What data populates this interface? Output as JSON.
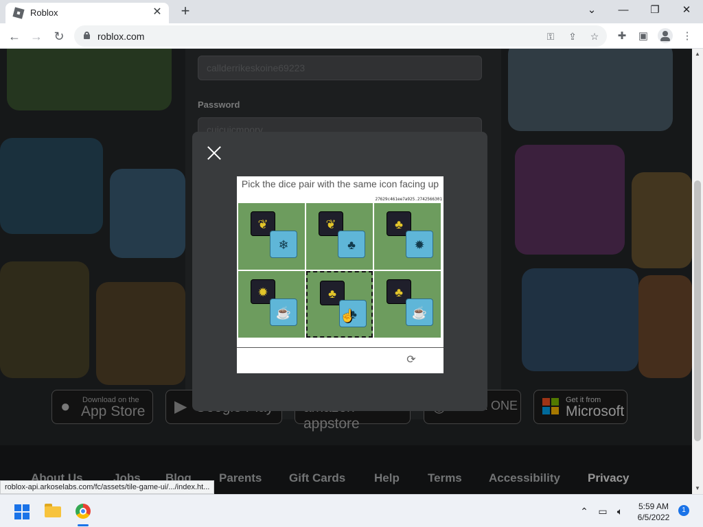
{
  "browser": {
    "tab_title": "Roblox",
    "url": "roblox.com",
    "tab_close": "✕",
    "new_tab": "+"
  },
  "login": {
    "username_value": "callderrikeskoine69223",
    "password_label": "Password",
    "password_value": "cuicuicmpory"
  },
  "captcha": {
    "prompt": "Pick the dice pair with the same icon facing up",
    "session_id": "27629c461ee7a925.2742566301",
    "selected_index": 4,
    "tiles": [
      {
        "dice": [
          "leaf",
          "snowflake"
        ]
      },
      {
        "dice": [
          "leaf",
          "tree"
        ]
      },
      {
        "dice": [
          "tree",
          "sun"
        ]
      },
      {
        "dice": [
          "sun",
          "cup"
        ]
      },
      {
        "dice": [
          "tree",
          "tree"
        ]
      },
      {
        "dice": [
          "tree",
          "cup"
        ]
      }
    ]
  },
  "store_badges": [
    {
      "small": "Download on the",
      "big": "App Store"
    },
    {
      "small": "",
      "big": "Google Play"
    },
    {
      "small": "",
      "big": "amazon appstore"
    },
    {
      "small": "",
      "big": "XBOX ONE"
    },
    {
      "small": "Get it from",
      "big": "Microsoft"
    }
  ],
  "footer_links": [
    "About Us",
    "Jobs",
    "Blog",
    "Parents",
    "Gift Cards",
    "Help",
    "Terms",
    "Accessibility",
    "Privacy"
  ],
  "status_bar_url": "roblox-api.arkoselabs.com/fc/assets/tile-game-ui/.../index.ht...",
  "taskbar": {
    "time": "5:59 AM",
    "date": "6/5/2022",
    "notifications": "1"
  }
}
